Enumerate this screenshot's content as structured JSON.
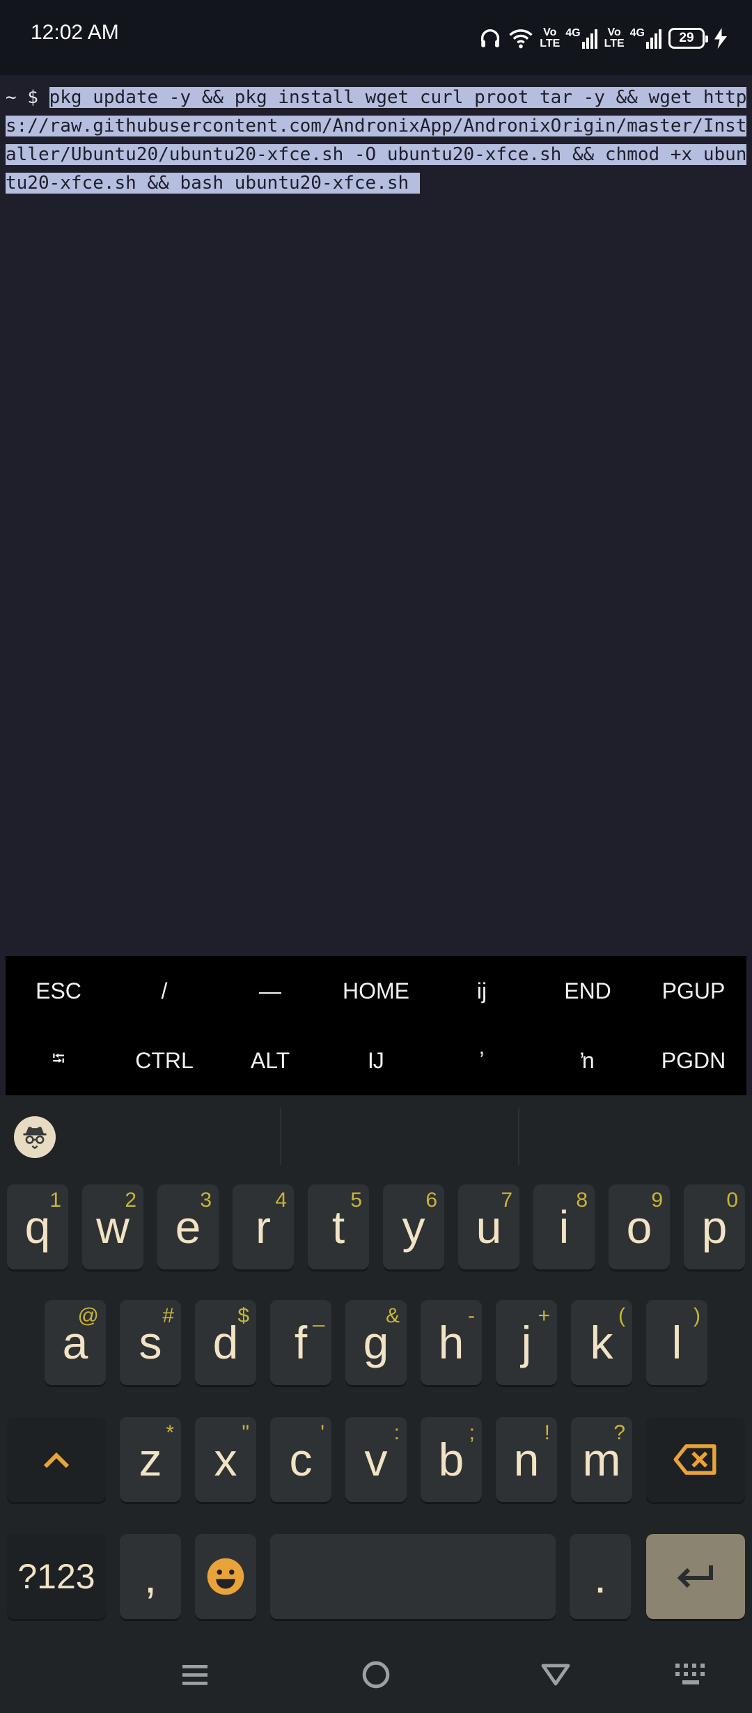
{
  "status_bar": {
    "time": "12:02 AM",
    "icons": [
      "headphones-icon",
      "wifi-icon",
      "volte-icon",
      "signal-4g-icon",
      "volte-icon",
      "signal-4g-icon",
      "battery-icon",
      "charging-icon"
    ],
    "volte_label_1": "Vo\nLTE",
    "net_label_1": "4G",
    "volte_label_2": "Vo\nLTE",
    "net_label_2": "4G",
    "battery_level": "29"
  },
  "terminal": {
    "prompt": "~ $ ",
    "command": "pkg update -y && pkg install wget curl proot tar -y && wget https://raw.githubusercontent.com/AndronixApp/AndronixOrigin/master/Installer/Ubuntu20/ubuntu20-xfce.sh -O ubuntu20-xfce.sh && chmod +x ubuntu20-xfce.sh && bash ubuntu20-xfce.sh "
  },
  "extra_keys": {
    "row1": [
      "ESC",
      "/",
      "—",
      "HOME",
      "ĳ",
      "END",
      "PGUP"
    ],
    "row2": [
      "⭾",
      "CTRL",
      "ALT",
      "Ĳ",
      "ʼ",
      "ŉ",
      "PGDN"
    ]
  },
  "keyboard": {
    "row1": [
      {
        "key": "q",
        "hint": "1"
      },
      {
        "key": "w",
        "hint": "2"
      },
      {
        "key": "e",
        "hint": "3"
      },
      {
        "key": "r",
        "hint": "4"
      },
      {
        "key": "t",
        "hint": "5"
      },
      {
        "key": "y",
        "hint": "6"
      },
      {
        "key": "u",
        "hint": "7"
      },
      {
        "key": "i",
        "hint": "8"
      },
      {
        "key": "o",
        "hint": "9"
      },
      {
        "key": "p",
        "hint": "0"
      }
    ],
    "row2": [
      {
        "key": "a",
        "hint": "@"
      },
      {
        "key": "s",
        "hint": "#"
      },
      {
        "key": "d",
        "hint": "$"
      },
      {
        "key": "f",
        "hint": "_"
      },
      {
        "key": "g",
        "hint": "&"
      },
      {
        "key": "h",
        "hint": "-"
      },
      {
        "key": "j",
        "hint": "+"
      },
      {
        "key": "k",
        "hint": "("
      },
      {
        "key": "l",
        "hint": ")"
      }
    ],
    "row3": [
      {
        "key": "z",
        "hint": "*"
      },
      {
        "key": "x",
        "hint": "\""
      },
      {
        "key": "c",
        "hint": "'"
      },
      {
        "key": "v",
        "hint": ":"
      },
      {
        "key": "b",
        "hint": ";"
      },
      {
        "key": "n",
        "hint": "!"
      },
      {
        "key": "m",
        "hint": "?"
      }
    ],
    "symbols_label": "?123",
    "comma_label": ",",
    "period_label": ".",
    "accent_color": "#e8a33a",
    "key_text_color": "#f1e3c4",
    "hint_color": "#c9b437"
  },
  "navbar": {
    "icons": [
      "menu-icon",
      "home-icon",
      "back-icon",
      "keyboard-switch-icon"
    ]
  }
}
